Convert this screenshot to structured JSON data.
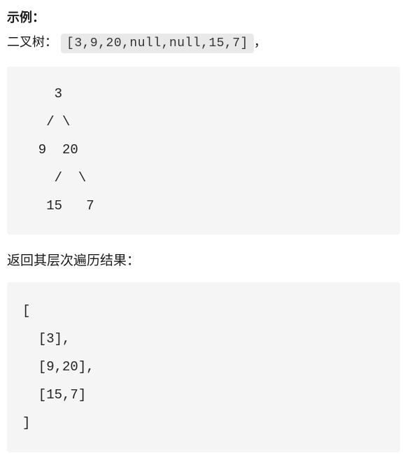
{
  "heading": "示例：",
  "desc_prefix": "二叉树：",
  "input_array": "[3,9,20,null,null,15,7]",
  "desc_suffix": "，",
  "tree_diagram": "    3\n   / \\\n  9  20\n    /  \\\n   15   7",
  "result_label": "返回其层次遍历结果：",
  "output_code": "[\n  [3],\n  [9,20],\n  [15,7]\n]"
}
